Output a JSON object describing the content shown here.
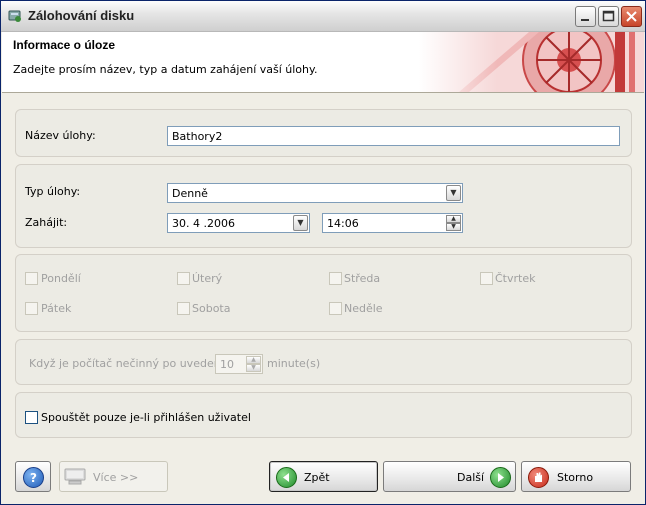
{
  "window": {
    "title": "Zálohování disku"
  },
  "header": {
    "title": "Informace o úloze",
    "subtitle": "Zadejte prosím název, typ a datum zahájení vaší úlohy."
  },
  "task_name": {
    "label": "Název úlohy:",
    "value": "Bathory2"
  },
  "schedule": {
    "type_label": "Typ úlohy:",
    "type_value": "Denně",
    "start_label": "Zahájit:",
    "date_value": "30. 4 .2006",
    "time_value": "14:06"
  },
  "days": {
    "items": [
      "Pondělí",
      "Úterý",
      "Středa",
      "Čtvrtek",
      "Pátek",
      "Sobota",
      "Neděle"
    ]
  },
  "idle": {
    "label": "Když je počítač nečinný po uvedený",
    "value": "10",
    "unit": "minute(s)"
  },
  "user_only": {
    "label": "Spouštět pouze je-li přihlášen uživatel"
  },
  "buttons": {
    "more": "Více >>",
    "back": "Zpět",
    "next": "Další",
    "cancel": "Storno"
  },
  "colors": {
    "title_border": "#0a246a",
    "close_button": "#c8452a",
    "header_art": "#d83a3a"
  }
}
